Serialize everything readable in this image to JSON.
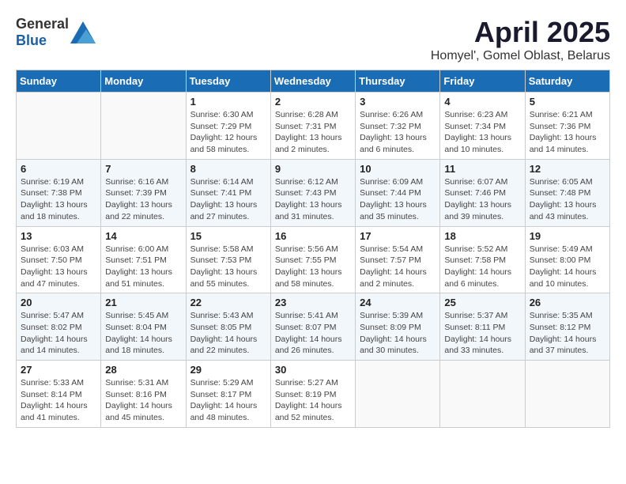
{
  "header": {
    "logo_general": "General",
    "logo_blue": "Blue",
    "month": "April 2025",
    "location": "Homyel', Gomel Oblast, Belarus"
  },
  "weekdays": [
    "Sunday",
    "Monday",
    "Tuesday",
    "Wednesday",
    "Thursday",
    "Friday",
    "Saturday"
  ],
  "weeks": [
    [
      {
        "day": "",
        "info": ""
      },
      {
        "day": "",
        "info": ""
      },
      {
        "day": "1",
        "info": "Sunrise: 6:30 AM\nSunset: 7:29 PM\nDaylight: 12 hours and 58 minutes."
      },
      {
        "day": "2",
        "info": "Sunrise: 6:28 AM\nSunset: 7:31 PM\nDaylight: 13 hours and 2 minutes."
      },
      {
        "day": "3",
        "info": "Sunrise: 6:26 AM\nSunset: 7:32 PM\nDaylight: 13 hours and 6 minutes."
      },
      {
        "day": "4",
        "info": "Sunrise: 6:23 AM\nSunset: 7:34 PM\nDaylight: 13 hours and 10 minutes."
      },
      {
        "day": "5",
        "info": "Sunrise: 6:21 AM\nSunset: 7:36 PM\nDaylight: 13 hours and 14 minutes."
      }
    ],
    [
      {
        "day": "6",
        "info": "Sunrise: 6:19 AM\nSunset: 7:38 PM\nDaylight: 13 hours and 18 minutes."
      },
      {
        "day": "7",
        "info": "Sunrise: 6:16 AM\nSunset: 7:39 PM\nDaylight: 13 hours and 22 minutes."
      },
      {
        "day": "8",
        "info": "Sunrise: 6:14 AM\nSunset: 7:41 PM\nDaylight: 13 hours and 27 minutes."
      },
      {
        "day": "9",
        "info": "Sunrise: 6:12 AM\nSunset: 7:43 PM\nDaylight: 13 hours and 31 minutes."
      },
      {
        "day": "10",
        "info": "Sunrise: 6:09 AM\nSunset: 7:44 PM\nDaylight: 13 hours and 35 minutes."
      },
      {
        "day": "11",
        "info": "Sunrise: 6:07 AM\nSunset: 7:46 PM\nDaylight: 13 hours and 39 minutes."
      },
      {
        "day": "12",
        "info": "Sunrise: 6:05 AM\nSunset: 7:48 PM\nDaylight: 13 hours and 43 minutes."
      }
    ],
    [
      {
        "day": "13",
        "info": "Sunrise: 6:03 AM\nSunset: 7:50 PM\nDaylight: 13 hours and 47 minutes."
      },
      {
        "day": "14",
        "info": "Sunrise: 6:00 AM\nSunset: 7:51 PM\nDaylight: 13 hours and 51 minutes."
      },
      {
        "day": "15",
        "info": "Sunrise: 5:58 AM\nSunset: 7:53 PM\nDaylight: 13 hours and 55 minutes."
      },
      {
        "day": "16",
        "info": "Sunrise: 5:56 AM\nSunset: 7:55 PM\nDaylight: 13 hours and 58 minutes."
      },
      {
        "day": "17",
        "info": "Sunrise: 5:54 AM\nSunset: 7:57 PM\nDaylight: 14 hours and 2 minutes."
      },
      {
        "day": "18",
        "info": "Sunrise: 5:52 AM\nSunset: 7:58 PM\nDaylight: 14 hours and 6 minutes."
      },
      {
        "day": "19",
        "info": "Sunrise: 5:49 AM\nSunset: 8:00 PM\nDaylight: 14 hours and 10 minutes."
      }
    ],
    [
      {
        "day": "20",
        "info": "Sunrise: 5:47 AM\nSunset: 8:02 PM\nDaylight: 14 hours and 14 minutes."
      },
      {
        "day": "21",
        "info": "Sunrise: 5:45 AM\nSunset: 8:04 PM\nDaylight: 14 hours and 18 minutes."
      },
      {
        "day": "22",
        "info": "Sunrise: 5:43 AM\nSunset: 8:05 PM\nDaylight: 14 hours and 22 minutes."
      },
      {
        "day": "23",
        "info": "Sunrise: 5:41 AM\nSunset: 8:07 PM\nDaylight: 14 hours and 26 minutes."
      },
      {
        "day": "24",
        "info": "Sunrise: 5:39 AM\nSunset: 8:09 PM\nDaylight: 14 hours and 30 minutes."
      },
      {
        "day": "25",
        "info": "Sunrise: 5:37 AM\nSunset: 8:11 PM\nDaylight: 14 hours and 33 minutes."
      },
      {
        "day": "26",
        "info": "Sunrise: 5:35 AM\nSunset: 8:12 PM\nDaylight: 14 hours and 37 minutes."
      }
    ],
    [
      {
        "day": "27",
        "info": "Sunrise: 5:33 AM\nSunset: 8:14 PM\nDaylight: 14 hours and 41 minutes."
      },
      {
        "day": "28",
        "info": "Sunrise: 5:31 AM\nSunset: 8:16 PM\nDaylight: 14 hours and 45 minutes."
      },
      {
        "day": "29",
        "info": "Sunrise: 5:29 AM\nSunset: 8:17 PM\nDaylight: 14 hours and 48 minutes."
      },
      {
        "day": "30",
        "info": "Sunrise: 5:27 AM\nSunset: 8:19 PM\nDaylight: 14 hours and 52 minutes."
      },
      {
        "day": "",
        "info": ""
      },
      {
        "day": "",
        "info": ""
      },
      {
        "day": "",
        "info": ""
      }
    ]
  ]
}
